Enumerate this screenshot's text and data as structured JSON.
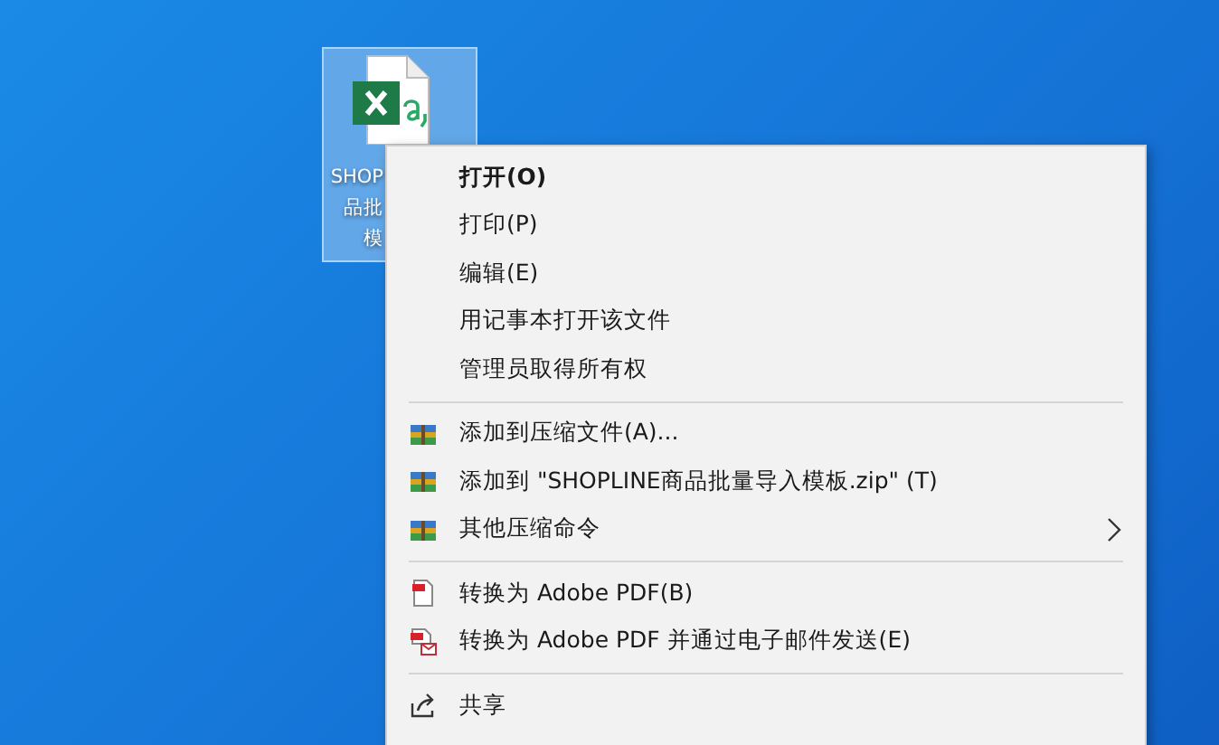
{
  "desktop_icon": {
    "label_lines": [
      "SHOP",
      "品批",
      "模"
    ],
    "selected": true
  },
  "context_menu": {
    "sections": [
      {
        "items": [
          {
            "label": "打开(O)",
            "default": true,
            "kind": "plain",
            "submenu": false
          },
          {
            "label": "打印(P)",
            "default": false,
            "kind": "plain",
            "submenu": false
          },
          {
            "label": "编辑(E)",
            "default": false,
            "kind": "plain",
            "submenu": false
          },
          {
            "label": "用记事本打开该文件",
            "default": false,
            "kind": "plain",
            "submenu": false
          },
          {
            "label": "管理员取得所有权",
            "default": false,
            "kind": "plain",
            "submenu": false
          }
        ]
      },
      {
        "items": [
          {
            "label": "添加到压缩文件(A)...",
            "default": false,
            "kind": "archive",
            "submenu": false
          },
          {
            "label": "添加到 \"SHOPLINE商品批量导入模板.zip\" (T)",
            "default": false,
            "kind": "archive",
            "submenu": false
          },
          {
            "label": "其他压缩命令",
            "default": false,
            "kind": "archive",
            "submenu": true
          }
        ]
      },
      {
        "items": [
          {
            "label": "转换为 Adobe PDF(B)",
            "default": false,
            "kind": "pdf",
            "submenu": false
          },
          {
            "label": "转换为 Adobe PDF 并通过电子邮件发送(E)",
            "default": false,
            "kind": "mail",
            "submenu": false
          }
        ]
      },
      {
        "items": [
          {
            "label": "共享",
            "default": false,
            "kind": "share",
            "submenu": false
          }
        ]
      }
    ]
  }
}
